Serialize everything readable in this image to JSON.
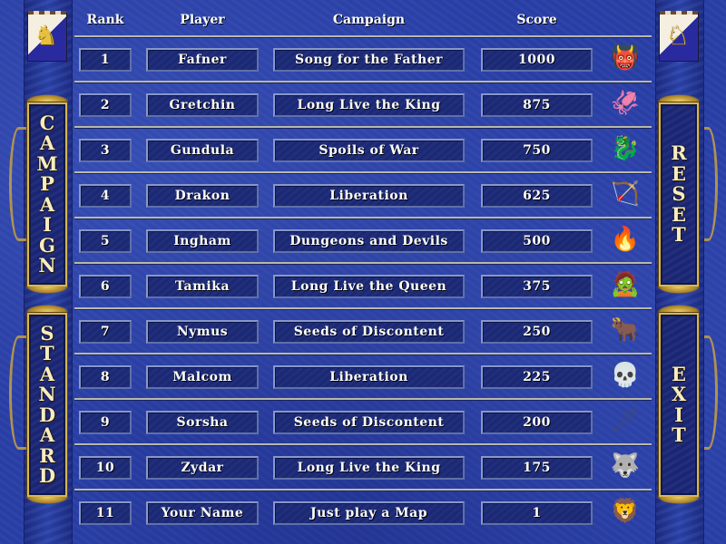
{
  "screen": "High Scores",
  "headers": {
    "rank": "Rank",
    "player": "Player",
    "campaign": "Campaign",
    "score": "Score"
  },
  "side_buttons": {
    "campaign": {
      "label": "CAMPAIGN",
      "letters": [
        "C",
        "A",
        "M",
        "P",
        "A",
        "I",
        "G",
        "N"
      ]
    },
    "standard": {
      "label": "STANDARD",
      "letters": [
        "S",
        "T",
        "A",
        "N",
        "D",
        "A",
        "R",
        "D"
      ]
    },
    "reset": {
      "label": "RESET",
      "letters": [
        "R",
        "E",
        "S",
        "E",
        "T"
      ]
    },
    "exit": {
      "label": "EXIT",
      "letters": [
        "E",
        "X",
        "I",
        "T"
      ]
    }
  },
  "banners": {
    "left": "griffin-banner",
    "right": "griffin-banner"
  },
  "rows": [
    {
      "rank": "1",
      "player": "Fafner",
      "campaign": "Song for the Father",
      "score": "1000",
      "creature": "troll",
      "creature_color": "#5a8a30",
      "glyph": "👹"
    },
    {
      "rank": "2",
      "player": "Gretchin",
      "campaign": "Long Live the King",
      "score": "875",
      "creature": "beholder",
      "creature_color": "#c0604a",
      "glyph": "🦑"
    },
    {
      "rank": "3",
      "player": "Gundula",
      "campaign": "Spoils of War",
      "score": "750",
      "creature": "wyvern",
      "creature_color": "#90c060",
      "glyph": "🐉"
    },
    {
      "rank": "4",
      "player": "Drakon",
      "campaign": "Liberation",
      "score": "625",
      "creature": "elf-archer",
      "creature_color": "#3a9a40",
      "glyph": "🏹"
    },
    {
      "rank": "5",
      "player": "Ingham",
      "campaign": "Dungeons and Devils",
      "score": "500",
      "creature": "efreet",
      "creature_color": "#d07a20",
      "glyph": "🔥"
    },
    {
      "rank": "6",
      "player": "Tamika",
      "campaign": "Long Live the Queen",
      "score": "375",
      "creature": "zombie",
      "creature_color": "#8a8070",
      "glyph": "🧟"
    },
    {
      "rank": "7",
      "player": "Nymus",
      "campaign": "Seeds of Discontent",
      "score": "250",
      "creature": "minotaur",
      "creature_color": "#8a5020",
      "glyph": "🐂"
    },
    {
      "rank": "8",
      "player": "Malcom",
      "campaign": "Liberation",
      "score": "225",
      "creature": "skeleton",
      "creature_color": "#e0d8c0",
      "glyph": "💀"
    },
    {
      "rank": "9",
      "player": "Sorsha",
      "campaign": "Seeds of Discontent",
      "score": "200",
      "creature": "pikeman",
      "creature_color": "#3a4a80",
      "glyph": "🗡"
    },
    {
      "rank": "10",
      "player": "Zydar",
      "campaign": "Long Live the King",
      "score": "175",
      "creature": "gnoll",
      "creature_color": "#7a7a40",
      "glyph": "🐺"
    },
    {
      "rank": "11",
      "player": "Your Name",
      "campaign": "Just play a Map",
      "score": "1",
      "creature": "gold-golem",
      "creature_color": "#d0a030",
      "glyph": "🦁"
    }
  ]
}
